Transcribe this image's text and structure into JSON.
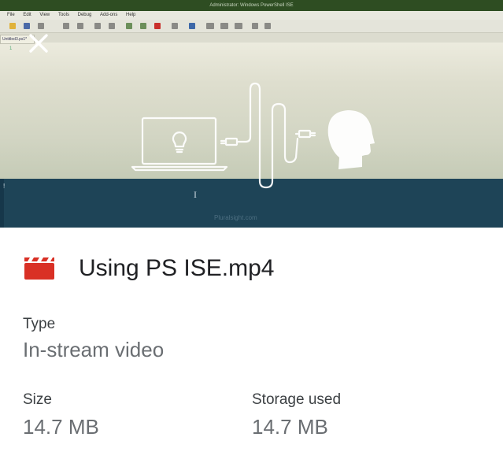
{
  "preview": {
    "window_title": "Administrator: Windows PowerShell ISE",
    "menu_items": [
      "File",
      "Edit",
      "View",
      "Tools",
      "Debug",
      "Add-ons",
      "Help"
    ],
    "script_tab": "Untitled3.ps1*",
    "line_number": "1",
    "console_marker": "!",
    "watermark": "Pluralsight.com"
  },
  "file": {
    "icon": "video-clapperboard-icon",
    "icon_color": "#d93025",
    "name": "Using PS ISE.mp4"
  },
  "details": {
    "type_label": "Type",
    "type_value": "In-stream video",
    "size_label": "Size",
    "size_value": "14.7 MB",
    "storage_label": "Storage used",
    "storage_value": "14.7 MB"
  }
}
